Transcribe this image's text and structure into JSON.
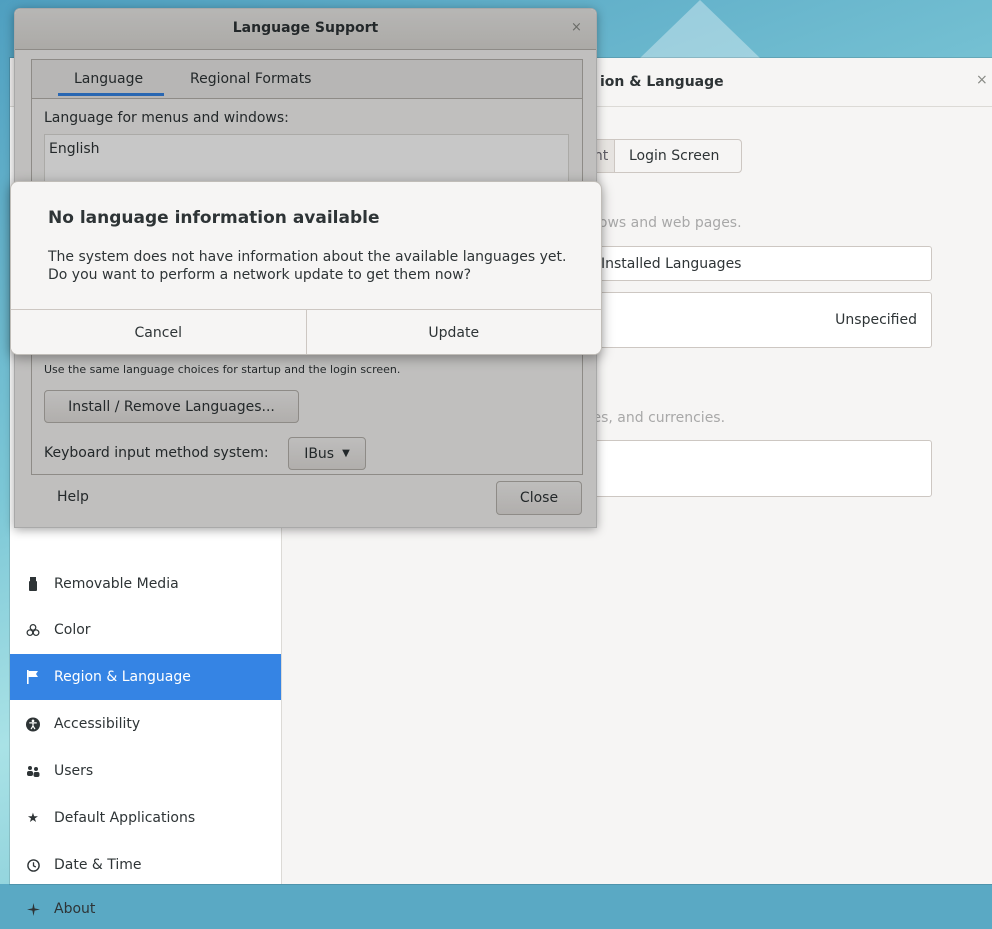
{
  "settings": {
    "title": "ion & Language",
    "close_glyph": "×",
    "tabs": {
      "account": "unt",
      "login_screen": "Login Screen"
    },
    "language_caption": "dows and web pages.",
    "install_button": "Installed Languages",
    "formats_value": "Unspecified",
    "formats_caption": "tes, and currencies.",
    "sidebar": [
      {
        "label": "Removable Media",
        "icon": "usb-icon"
      },
      {
        "label": "Color",
        "icon": "color-icon"
      },
      {
        "label": "Region & Language",
        "icon": "flag-icon",
        "selected": true
      },
      {
        "label": "Accessibility",
        "icon": "accessibility-icon"
      },
      {
        "label": "Users",
        "icon": "users-icon"
      },
      {
        "label": "Default Applications",
        "icon": "star-icon"
      },
      {
        "label": "Date & Time",
        "icon": "clock-icon"
      },
      {
        "label": "About",
        "icon": "sparkle-icon"
      }
    ]
  },
  "language_support": {
    "title": "Language Support",
    "close_glyph": "×",
    "tabs": {
      "language": "Language",
      "regional": "Regional Formats"
    },
    "menus_label": "Language for menus and windows:",
    "languages": [
      "English"
    ],
    "same_choice_note": "Use the same language choices for startup and the login screen.",
    "install_remove": "Install / Remove Languages...",
    "im_label": "Keyboard input method system:",
    "im_value": "IBus",
    "help": "Help",
    "close": "Close"
  },
  "dialog": {
    "title": "No language information available",
    "body": "The system does not have information about the available languages yet. Do you want to perform a network update to get them now?",
    "cancel": "Cancel",
    "update": "Update"
  },
  "colors": {
    "accent": "#3584e4",
    "window_bg": "#f6f5f4",
    "text": "#2e3436"
  }
}
